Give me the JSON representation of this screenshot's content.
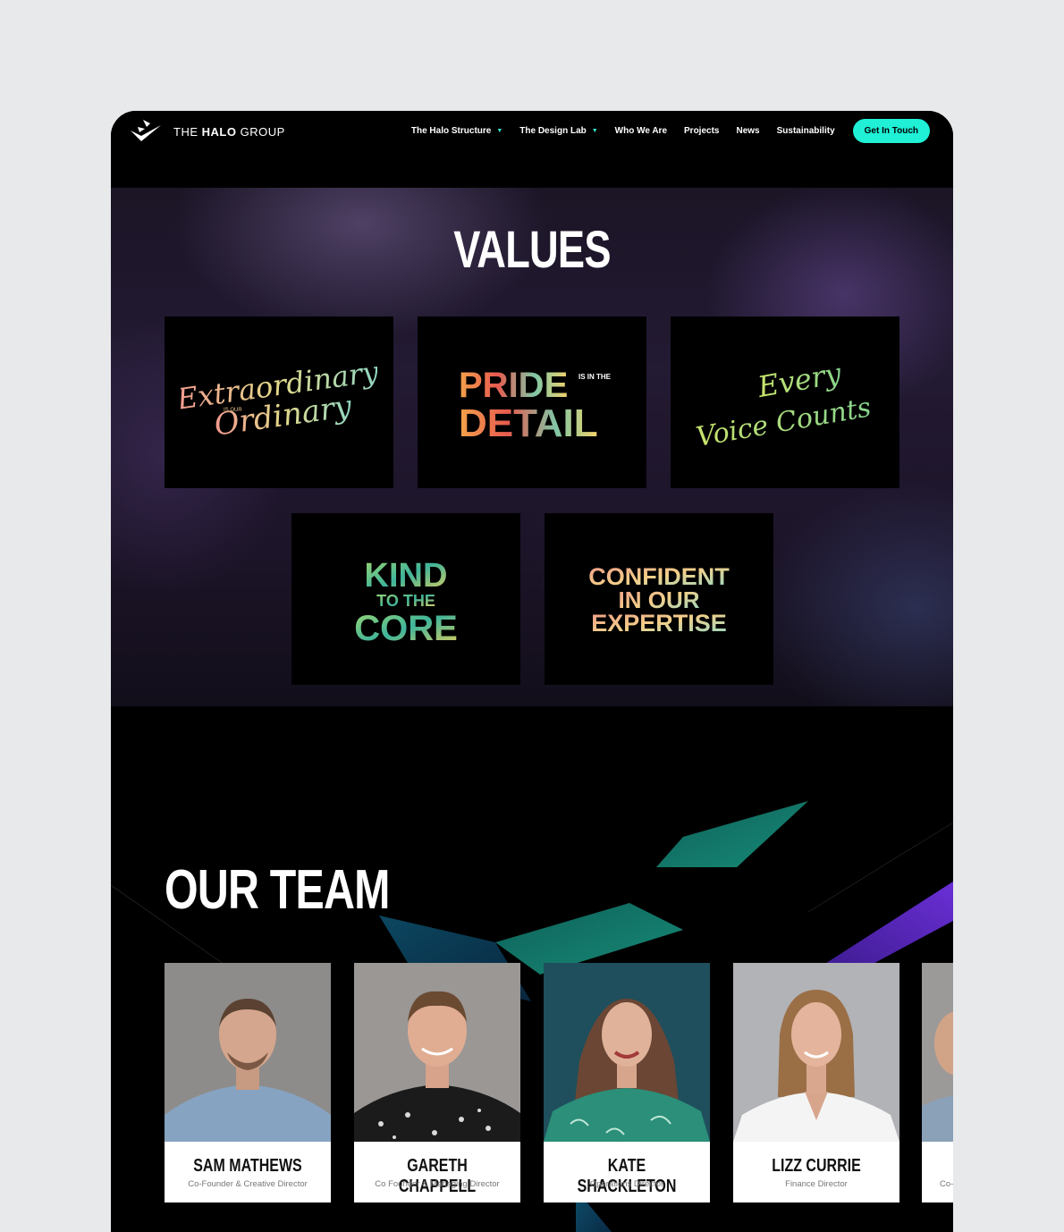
{
  "header": {
    "logo_prefix": "THE ",
    "logo_bold": "HALO",
    "logo_suffix": " GROUP",
    "nav": [
      {
        "label": "The Halo Structure",
        "has_caret": true
      },
      {
        "label": "The Design Lab",
        "has_caret": true
      },
      {
        "label": "Who We Are",
        "has_caret": false
      },
      {
        "label": "Projects",
        "has_caret": false
      },
      {
        "label": "News",
        "has_caret": false
      },
      {
        "label": "Sustainability",
        "has_caret": false
      }
    ],
    "cta": "Get In Touch",
    "accent": "#1ff0d6"
  },
  "values": {
    "title": "VALUES",
    "cards": [
      {
        "line1": "Extraordinary",
        "small": "IS OUR",
        "line2": "Ordinary"
      },
      {
        "line1": "PRIDE",
        "small": "IS IN THE",
        "line2": "DETAIL"
      },
      {
        "line1": "Every",
        "small": "",
        "line2": "Voice Counts"
      },
      {
        "line1": "KIND",
        "small": "TO THE",
        "line2": "CORE"
      },
      {
        "line1": "CONFIDENT",
        "small": "IN OUR",
        "line2": "EXPERTISE"
      }
    ]
  },
  "team": {
    "title": "OUR TEAM",
    "members": [
      {
        "name": "SAM MATHEWS",
        "role": "Co-Founder & Creative Director"
      },
      {
        "name": "GARETH CHAPPELL",
        "role": "Co Founder & Managing Director"
      },
      {
        "name": "KATE SHACKLETON",
        "role": "Operations Director"
      },
      {
        "name": "LIZZ CURRIE",
        "role": "Finance Director"
      },
      {
        "name": "",
        "role": "Co-"
      }
    ]
  }
}
